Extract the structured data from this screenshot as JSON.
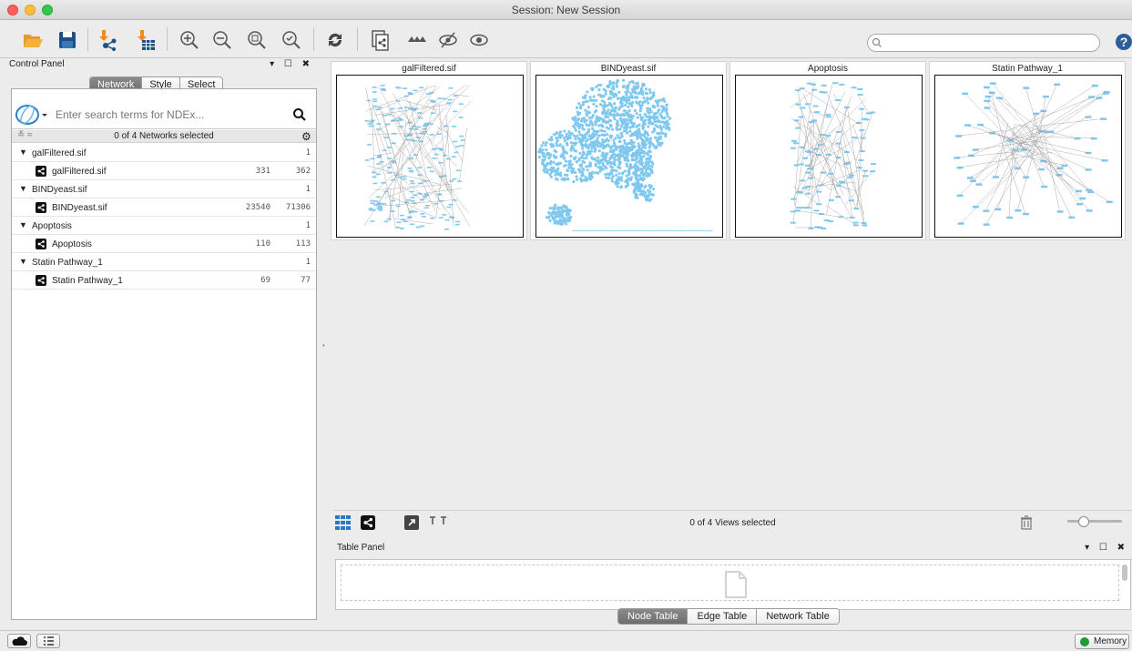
{
  "window": {
    "title": "Session: New Session"
  },
  "toolbar": {
    "icons": [
      "open-folder-icon",
      "save-icon",
      "import-network-icon",
      "import-table-icon",
      "zoom-in-icon",
      "zoom-out-icon",
      "zoom-fit-icon",
      "zoom-selected-icon",
      "refresh-icon",
      "new-network-icon",
      "hide-icon",
      "hide-selected-icon",
      "show-icon"
    ],
    "search_placeholder": "",
    "help_label": "?"
  },
  "control_panel": {
    "title": "Control Panel",
    "header_controls": "▾ ☐ ✖",
    "tabs": [
      {
        "label": "Network",
        "active": true
      },
      {
        "label": "Style",
        "active": false
      },
      {
        "label": "Select",
        "active": false
      }
    ],
    "ndex_search_placeholder": "Enter search terms for NDEx...",
    "selection_summary": "0 of 4 Networks selected",
    "expand_label": "≚ ≈",
    "networks": [
      {
        "collection": "galFiltered.sif",
        "collection_count": "1",
        "name": "galFiltered.sif",
        "nodes": "331",
        "edges": "362"
      },
      {
        "collection": "BINDyeast.sif",
        "collection_count": "1",
        "name": "BINDyeast.sif",
        "nodes": "23540",
        "edges": "71306"
      },
      {
        "collection": "Apoptosis",
        "collection_count": "1",
        "name": "Apoptosis",
        "nodes": "110",
        "edges": "113"
      },
      {
        "collection": "Statin Pathway_1",
        "collection_count": "1",
        "name": "Statin Pathway_1",
        "nodes": "69",
        "edges": "77"
      }
    ]
  },
  "network_views": {
    "thumbnails": [
      {
        "title": "galFiltered.sif"
      },
      {
        "title": "BINDyeast.sif"
      },
      {
        "title": "Apoptosis"
      },
      {
        "title": "Statin Pathway_1"
      }
    ],
    "selection_summary": "0 of 4 Views selected",
    "node_color": "#7fc8f0"
  },
  "table_panel": {
    "title": "Table Panel",
    "header_controls": "▾ ☐ ✖",
    "tabs": [
      {
        "label": "Node Table",
        "active": true
      },
      {
        "label": "Edge Table",
        "active": false
      },
      {
        "label": "Network Table",
        "active": false
      }
    ]
  },
  "statusbar": {
    "memory_label": "Memory",
    "memory_color": "#1f9a3a"
  }
}
